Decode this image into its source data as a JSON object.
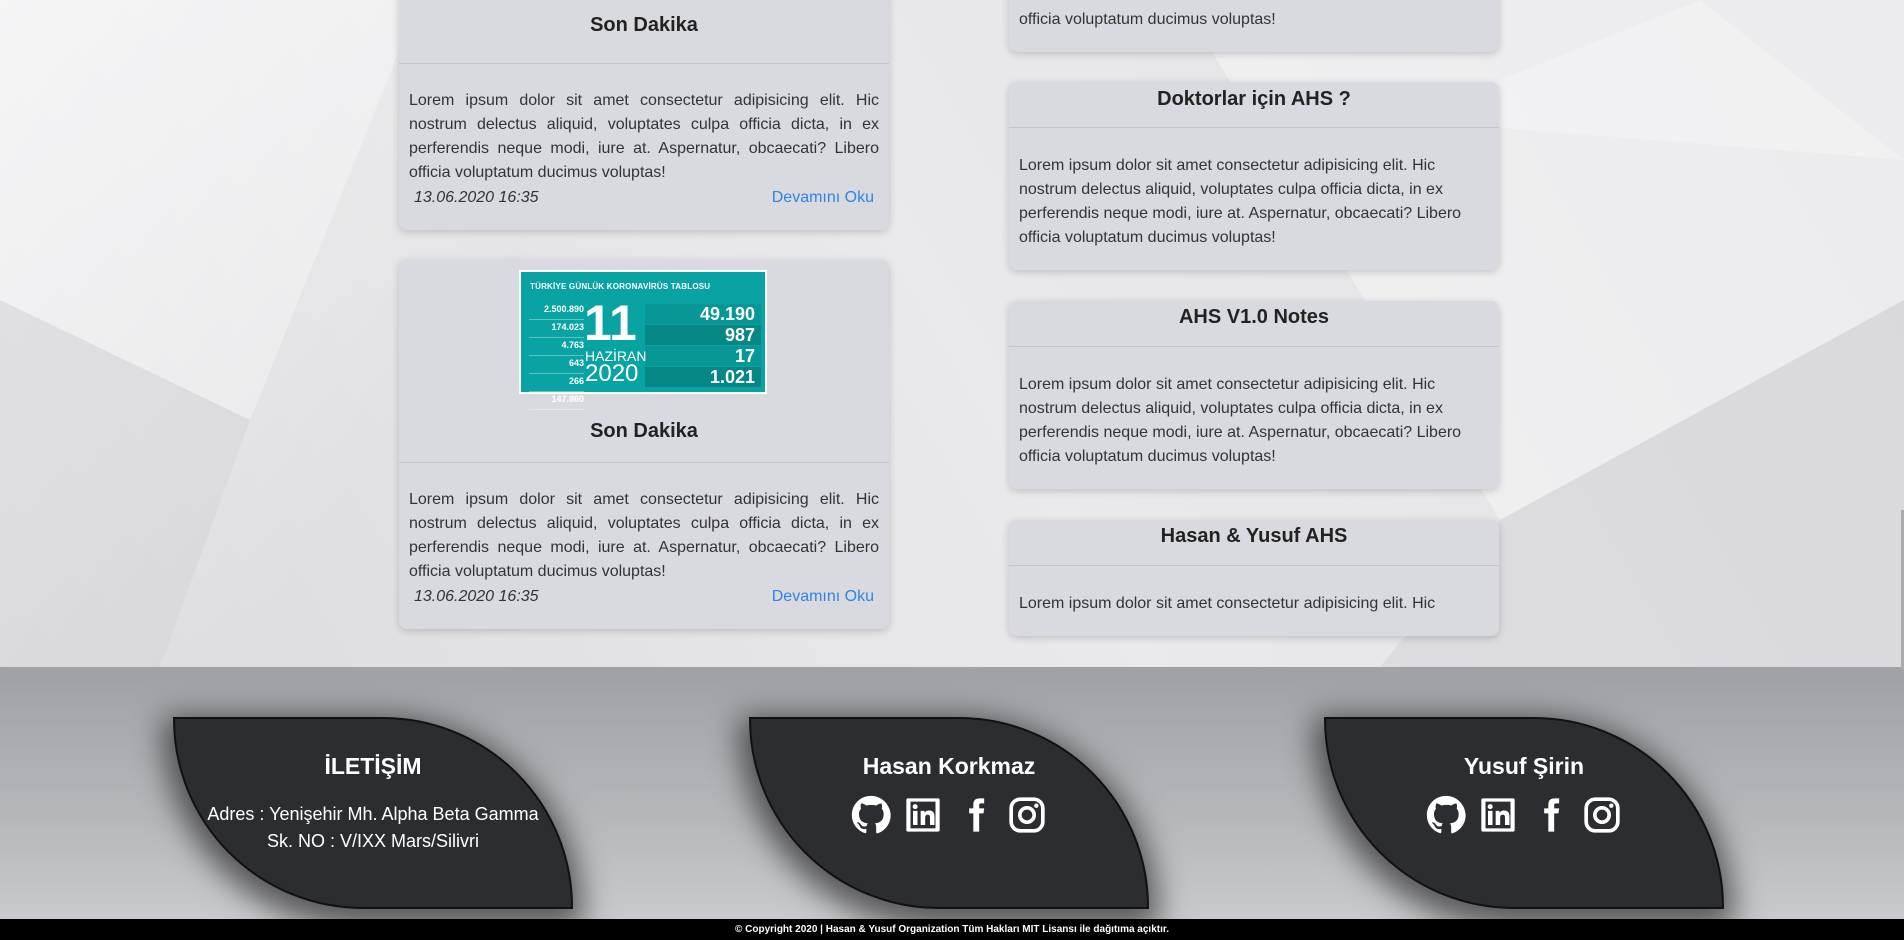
{
  "left_cards": [
    {
      "title": "Son Dakika",
      "text": "Lorem ipsum dolor sit amet consectetur adipisicing elit. Hic nostrum delectus aliquid, voluptates culpa officia dicta, in ex perferendis neque modi, iure at. Aspernatur, obcaecati? Libero officia voluptatum ducimus voluptas!",
      "date": "13.06.2020 16:35",
      "read_more": "Devamını Oku"
    },
    {
      "title": "Son Dakika",
      "text": "Lorem ipsum dolor sit amet consectetur adipisicing elit. Hic nostrum delectus aliquid, voluptates culpa officia dicta, in ex perferendis neque modi, iure at. Aspernatur, obcaecati? Libero officia voluptatum ducimus voluptas!",
      "date": "13.06.2020 16:35",
      "read_more": "Devamını Oku",
      "image": {
        "title": "TÜRKİYE GÜNLÜK KORONAVİRÜS TABLOSU",
        "day": "11",
        "month": "HAZİRAN",
        "year": "2020",
        "left_values": [
          "2.500.890",
          "174.023",
          "4.763",
          "643",
          "266",
          "147.860"
        ],
        "right_values": [
          "49.190",
          "987",
          "17",
          "1.021"
        ]
      }
    }
  ],
  "right_cards": [
    {
      "text": "officia voluptatum ducimus voluptas!"
    },
    {
      "title": "Doktorlar için AHS ?",
      "text": "Lorem ipsum dolor sit amet consectetur adipisicing elit. Hic nostrum delectus aliquid, voluptates culpa officia dicta, in ex perferendis neque modi, iure at. Aspernatur, obcaecati? Libero officia voluptatum ducimus voluptas!"
    },
    {
      "title": "AHS V1.0 Notes",
      "text": "Lorem ipsum dolor sit amet consectetur adipisicing elit. Hic nostrum delectus aliquid, voluptates culpa officia dicta, in ex perferendis neque modi, iure at. Aspernatur, obcaecati? Libero officia voluptatum ducimus voluptas!"
    },
    {
      "title": "Hasan & Yusuf AHS",
      "text": "Lorem ipsum dolor sit amet consectetur adipisicing elit. Hic"
    }
  ],
  "footer": {
    "contact": {
      "title": "İLETİŞİM",
      "address": "Adres : Yenişehir Mh. Alpha Beta Gamma Sk. NO : V/IXX Mars/Silivri"
    },
    "people": [
      {
        "name": "Hasan Korkmaz",
        "icons": [
          "github-icon",
          "linkedin-icon",
          "facebook-icon",
          "instagram-icon"
        ]
      },
      {
        "name": "Yusuf Şirin",
        "icons": [
          "github-icon",
          "linkedin-icon",
          "facebook-icon",
          "instagram-icon"
        ]
      }
    ],
    "copyright": "© Copyright 2020 | Hasan & Yusuf Organization Tüm Hakları MIT Lisansı ile dağıtıma açıktır."
  }
}
